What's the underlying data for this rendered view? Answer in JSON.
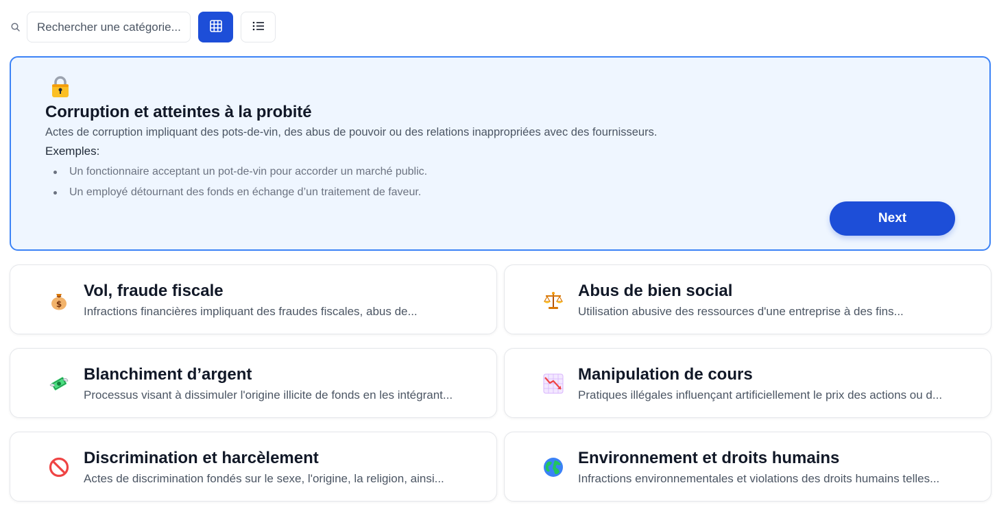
{
  "search": {
    "placeholder": "Rechercher une catégorie..."
  },
  "view_toggle": {
    "active": "grid",
    "accent": "#1d4ed8"
  },
  "featured": {
    "icon": "lock-icon",
    "title": "Corruption et atteintes à la probité",
    "description": "Actes de corruption impliquant des pots-de-vin, des abus de pouvoir ou des relations inappropriées avec des fournisseurs.",
    "examples_label": "Exemples:",
    "examples": [
      "Un fonctionnaire acceptant un pot-de-vin pour accorder un marché public.",
      "Un employé détournant des fonds en échange d’un traitement de faveur."
    ],
    "next_label": "Next",
    "background": "#eff6ff",
    "border": "#3b82f6"
  },
  "categories": [
    {
      "icon": "money-bag-icon",
      "title": "Vol, fraude fiscale",
      "description": "Infractions financières impliquant des fraudes fiscales, abus de..."
    },
    {
      "icon": "balance-scale-icon",
      "title": "Abus de bien social",
      "description": "Utilisation abusive des ressources d'une entreprise à des fins..."
    },
    {
      "icon": "money-with-wings-icon",
      "title": "Blanchiment d’argent",
      "description": "Processus visant à dissimuler l'origine illicite de fonds en les intégrant..."
    },
    {
      "icon": "chart-decreasing-icon",
      "title": "Manipulation de cours",
      "description": "Pratiques illégales influençant artificiellement le prix des actions ou d..."
    },
    {
      "icon": "prohibited-icon",
      "title": "Discrimination et harcèlement",
      "description": "Actes de discrimination fondés sur le sexe, l'origine, la religion, ainsi..."
    },
    {
      "icon": "globe-icon",
      "title": "Environnement et droits humains",
      "description": "Infractions environnementales et violations des droits humains telles..."
    }
  ]
}
